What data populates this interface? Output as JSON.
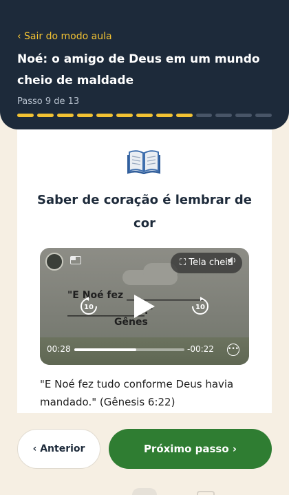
{
  "header": {
    "exit_label": "‹ Sair do modo aula",
    "title": "Noé: o amigo de Deus em um mundo cheio de maldade",
    "step_label": "Passo 9 de 13",
    "progress": {
      "current": 9,
      "total": 13
    }
  },
  "content": {
    "icon": "open-book-icon",
    "heading": "Saber de coração é lembrar de cor",
    "video": {
      "fullscreen_label": "Tela cheia",
      "frame_verse": "\"E Noé fez ________________ ________________.\"",
      "frame_reference": "Gênes",
      "rewind_label": "10",
      "forward_label": "10",
      "elapsed": "00:28",
      "remaining": "-00:22",
      "progress_fraction": 0.56
    },
    "verse_text": "\"E Noé fez tudo conforme Deus havia mandado.\" (Gênesis 6:22)"
  },
  "footer": {
    "prev_label": "‹ Anterior",
    "next_label": "Próximo passo ›"
  },
  "colors": {
    "header_bg": "#1d2a3a",
    "accent_yellow": "#f2c233",
    "next_button": "#2f7d32",
    "page_bg": "#f6efe3"
  }
}
